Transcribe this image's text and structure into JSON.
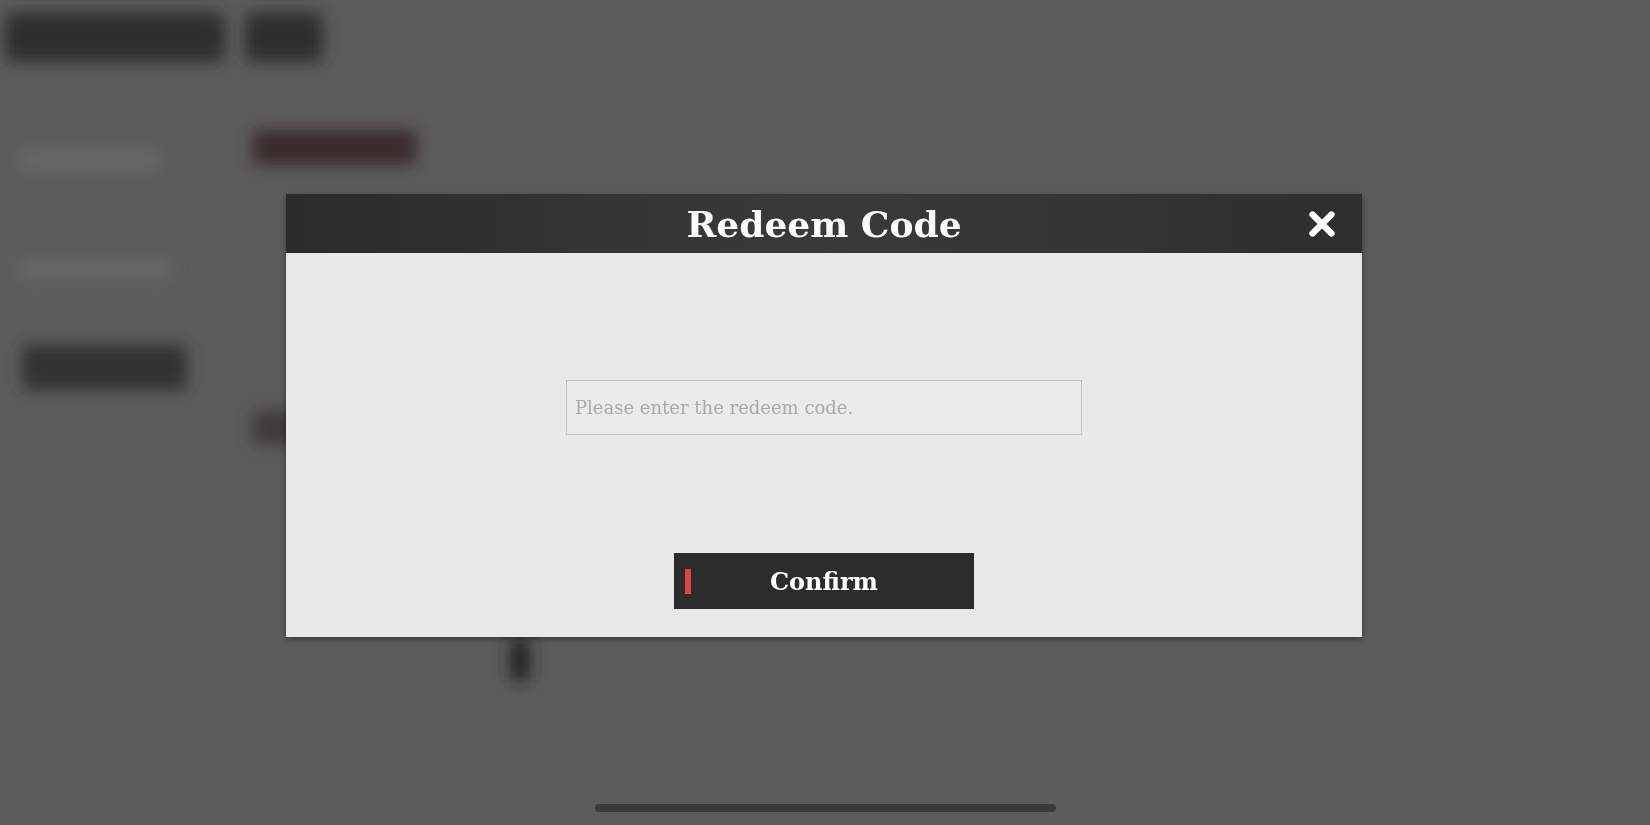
{
  "dialog": {
    "title": "Redeem Code",
    "input": {
      "placeholder": "Please enter the redeem code."
    },
    "confirm_button": {
      "label": "Confirm"
    }
  }
}
